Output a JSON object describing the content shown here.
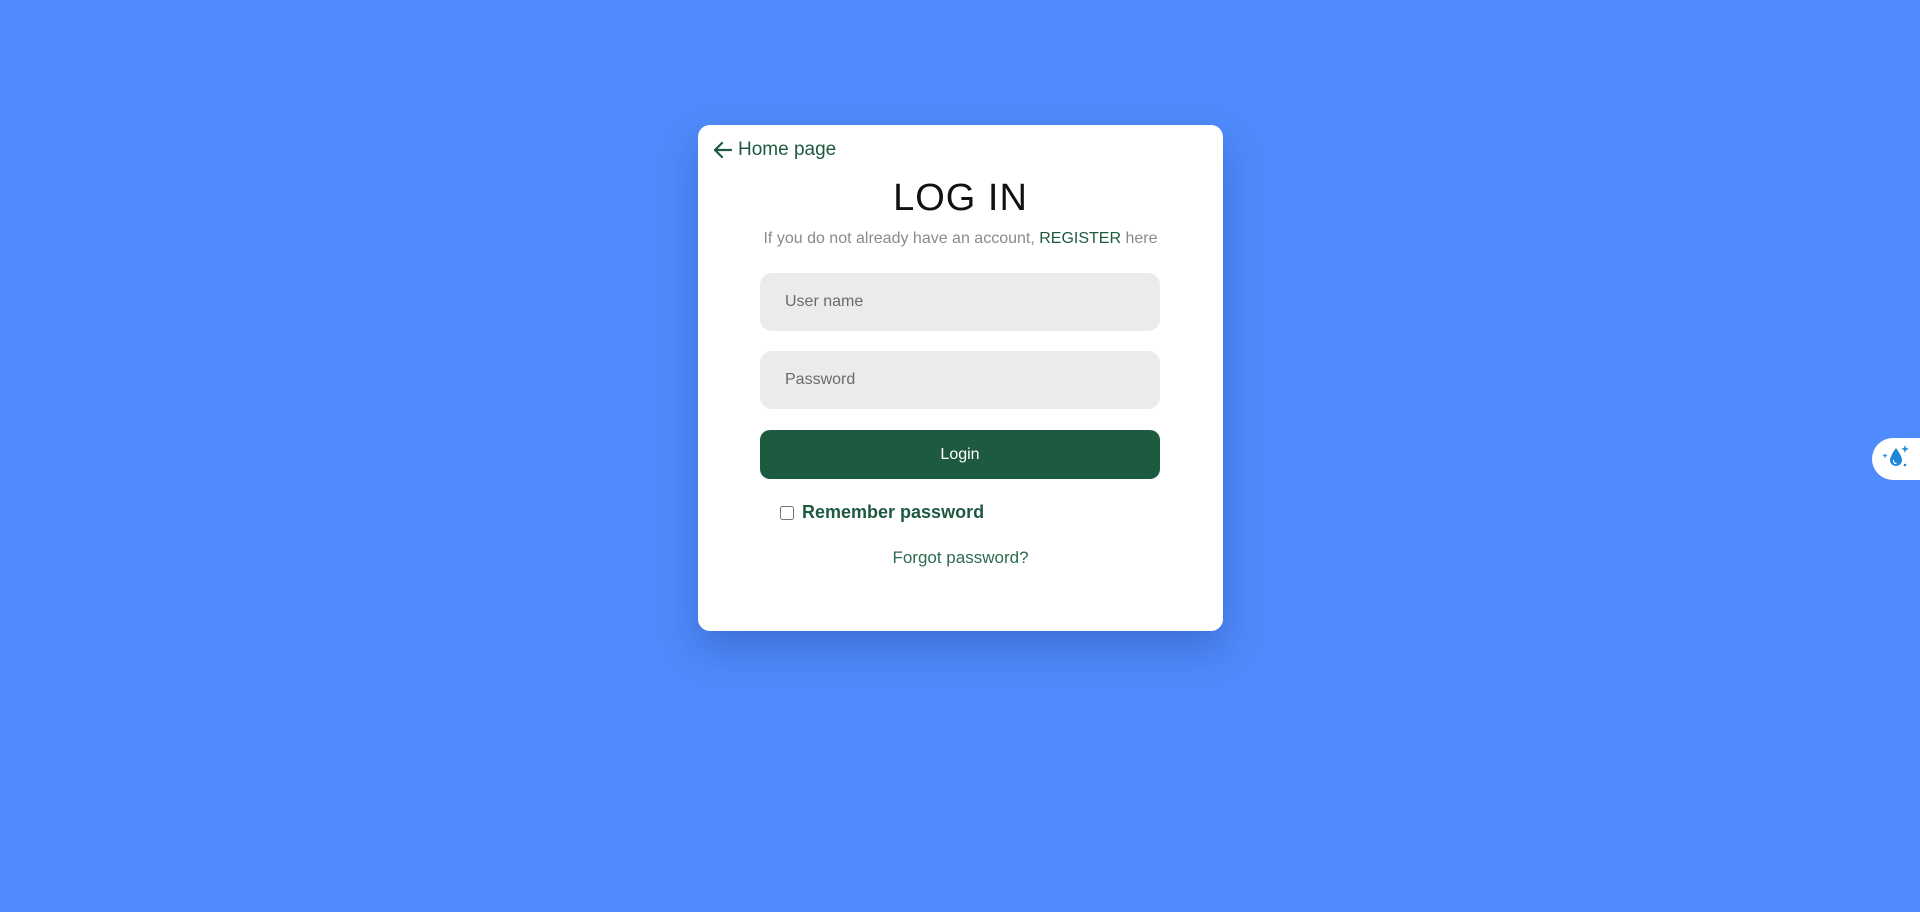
{
  "back_link": {
    "label": "Home page",
    "icon": "arrow-left-icon"
  },
  "login": {
    "title": "LOG IN",
    "subtitle_prefix": "If you do not already have an account, ",
    "register_label": "REGISTER",
    "subtitle_suffix": " here",
    "username_placeholder": "User name",
    "password_placeholder": "Password",
    "login_label": "Login",
    "remember_label": "Remember password",
    "forgot_label": "Forgot password?"
  },
  "side_widget": {
    "icon": "water-drop-sparkle-icon"
  },
  "colors": {
    "background": "#4f8bfc",
    "accent": "#1e5a40",
    "field_bg": "#ebebeb",
    "card_bg": "#ffffff"
  }
}
